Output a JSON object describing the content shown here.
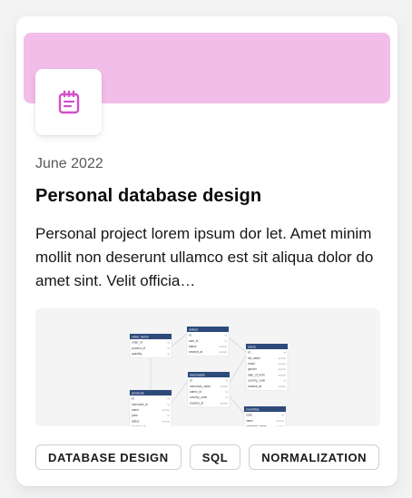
{
  "colors": {
    "banner": "#f2bde9",
    "icon_accent": "#d44fc8",
    "table_header": "#2d4a7b"
  },
  "card": {
    "icon": "calendar-clipboard-icon",
    "date": "June 2022",
    "title": "Personal database design",
    "description": "Personal project lorem ipsum dor let. Amet minim mollit non deserunt ullamco est sit aliqua dolor do amet sint. Velit officia…",
    "tags": [
      "DATABASE DESIGN",
      "SQL",
      "NORMALIZATION"
    ]
  },
  "diagram": {
    "tables": [
      {
        "name": "order_items",
        "fields": [
          [
            "order_id",
            "int"
          ],
          [
            "product_id",
            "int"
          ],
          [
            "quantity",
            "int"
          ]
        ]
      },
      {
        "name": "orders",
        "fields": [
          [
            "id",
            "int"
          ],
          [
            "user_id",
            "int"
          ],
          [
            "status",
            "varchar"
          ],
          [
            "created_at",
            "varchar"
          ]
        ]
      },
      {
        "name": "users",
        "fields": [
          [
            "id",
            "int"
          ],
          [
            "full_name",
            "varchar"
          ],
          [
            "email",
            "varchar"
          ],
          [
            "gender",
            "varchar"
          ],
          [
            "date_of_birth",
            "varchar"
          ],
          [
            "country_code",
            "int"
          ],
          [
            "created_at",
            "varchar"
          ]
        ]
      },
      {
        "name": "merchants",
        "fields": [
          [
            "id",
            "int"
          ],
          [
            "merchant_name",
            "varchar"
          ],
          [
            "admin_id",
            "int"
          ],
          [
            "country_code",
            "int"
          ],
          [
            "created_at",
            "varchar"
          ]
        ]
      },
      {
        "name": "products",
        "fields": [
          [
            "id",
            "int"
          ],
          [
            "merchant_id",
            "int"
          ],
          [
            "name",
            "varchar"
          ],
          [
            "price",
            "int"
          ],
          [
            "status",
            "varchar"
          ],
          [
            "created_at",
            "varchar"
          ]
        ]
      },
      {
        "name": "countries",
        "fields": [
          [
            "code",
            "int"
          ],
          [
            "name",
            "varchar"
          ],
          [
            "continent_name",
            "varchar"
          ]
        ]
      }
    ]
  }
}
